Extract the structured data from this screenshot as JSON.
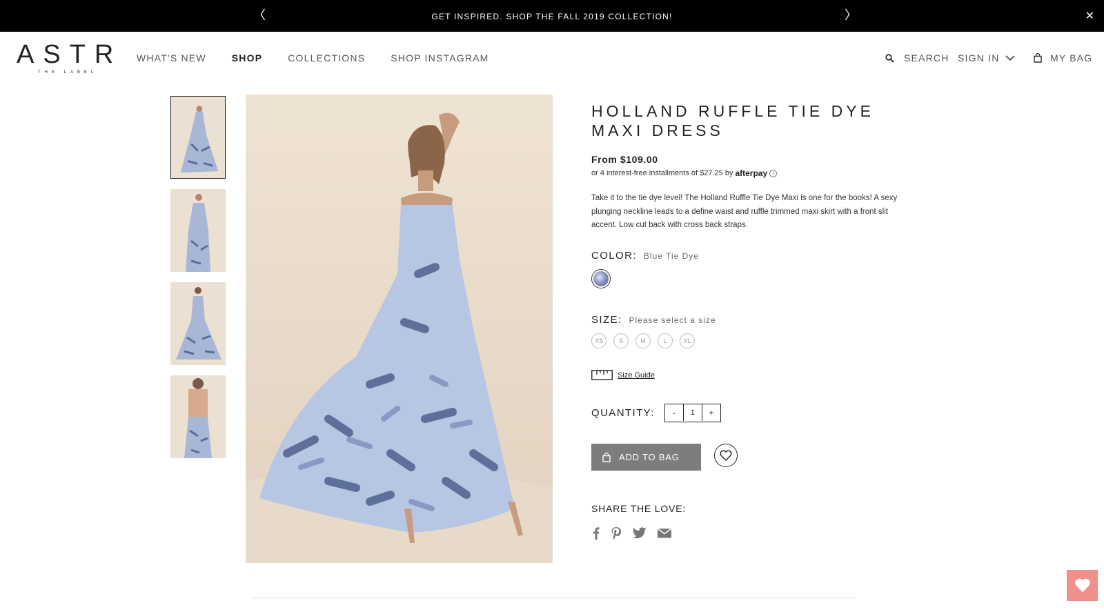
{
  "promo": {
    "text": "GET INSPIRED. SHOP THE FALL 2019 COLLECTION!",
    "prev": "〈",
    "next": "〉",
    "close": "✕"
  },
  "logo": {
    "main": "ASTR",
    "sub": "THE LABEL"
  },
  "nav": {
    "items": [
      {
        "label": "WHAT'S NEW"
      },
      {
        "label": "SHOP"
      },
      {
        "label": "COLLECTIONS"
      },
      {
        "label": "SHOP INSTAGRAM"
      }
    ]
  },
  "util": {
    "search": "SEARCH",
    "signin": "SIGN IN",
    "bag": "MY BAG"
  },
  "product": {
    "title": "HOLLAND RUFFLE TIE DYE MAXI DRESS",
    "price": "From $109.00",
    "afterpay_text": "or 4 interest-free installments of $27.25 by",
    "afterpay_logo": "afterpay",
    "afterpay_info": "i",
    "description": "Take it to the tie dye level! The Holland Ruffle Tie Dye Maxi is one for the books! A sexy plunging neckline leads to a define waist and ruffle trimmed maxi skirt with a front slit accent. Low cut back with cross back straps."
  },
  "color": {
    "label": "COLOR:",
    "value": "Blue Tie Dye"
  },
  "size": {
    "label": "SIZE:",
    "hint": "Please select a size",
    "options": [
      "XS",
      "S",
      "M",
      "L",
      "XL"
    ],
    "guide": "Size Guide"
  },
  "quantity": {
    "label": "QUANTITY:",
    "minus": "-",
    "value": "1",
    "plus": "+"
  },
  "add_to_bag": "ADD TO BAG",
  "share": {
    "label": "SHARE THE LOVE:"
  },
  "colors": {
    "promo_bg": "#000000",
    "button_gray": "#7d7d7d",
    "fav_pink": "#f0908a",
    "dress_blue": "#8d97c2"
  },
  "icons": [
    "search-icon",
    "chevron-down-icon",
    "bag-icon",
    "ruler-icon",
    "heart-icon",
    "facebook-icon",
    "pinterest-icon",
    "twitter-icon",
    "email-icon"
  ]
}
